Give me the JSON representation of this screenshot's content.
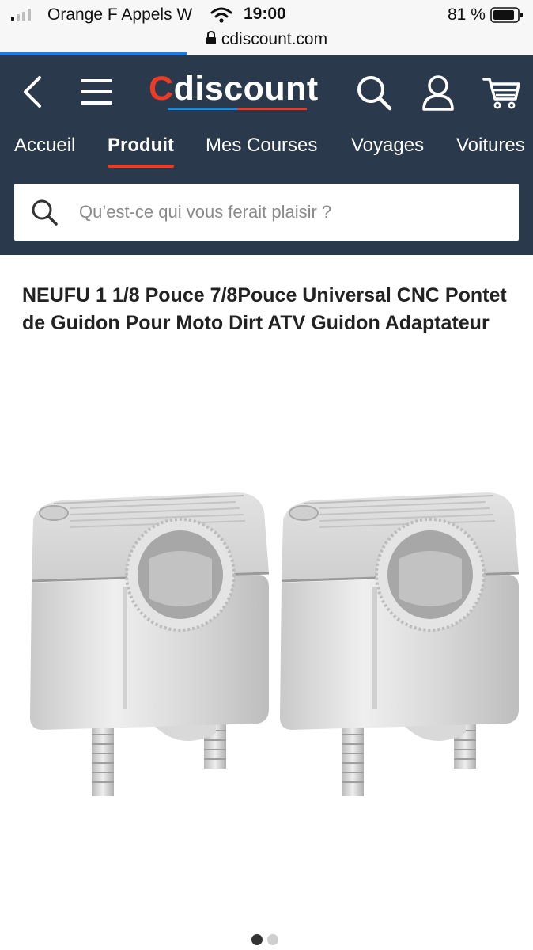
{
  "status_bar": {
    "carrier": "Orange F Appels W",
    "time": "19:00",
    "battery": "81 %"
  },
  "browser": {
    "url": "cdiscount.com",
    "load_progress": 0.35
  },
  "header": {
    "logo_first": "C",
    "logo_rest": "discount",
    "nav_tabs": [
      "Accueil",
      "Produit",
      "Mes Courses",
      "Voyages",
      "Voitures"
    ],
    "active_tab": "Produit",
    "icons": [
      "back-icon",
      "menu-icon",
      "search-icon",
      "account-icon",
      "cart-icon"
    ]
  },
  "search": {
    "placeholder": "Qu’est-ce qui vous ferait plaisir ?"
  },
  "product": {
    "title": "NEUFU 1 1/8 Pouce 7/8Pouce Universal CNC Pontet de Guidon Pour Moto Dirt ATV Guidon Adaptateur"
  },
  "gallery": {
    "current_image": 1,
    "total_images": 2
  },
  "colors": {
    "header_bg": "#2a3a4c",
    "accent_red": "#ea3b26",
    "accent_blue": "#1c8be0"
  }
}
